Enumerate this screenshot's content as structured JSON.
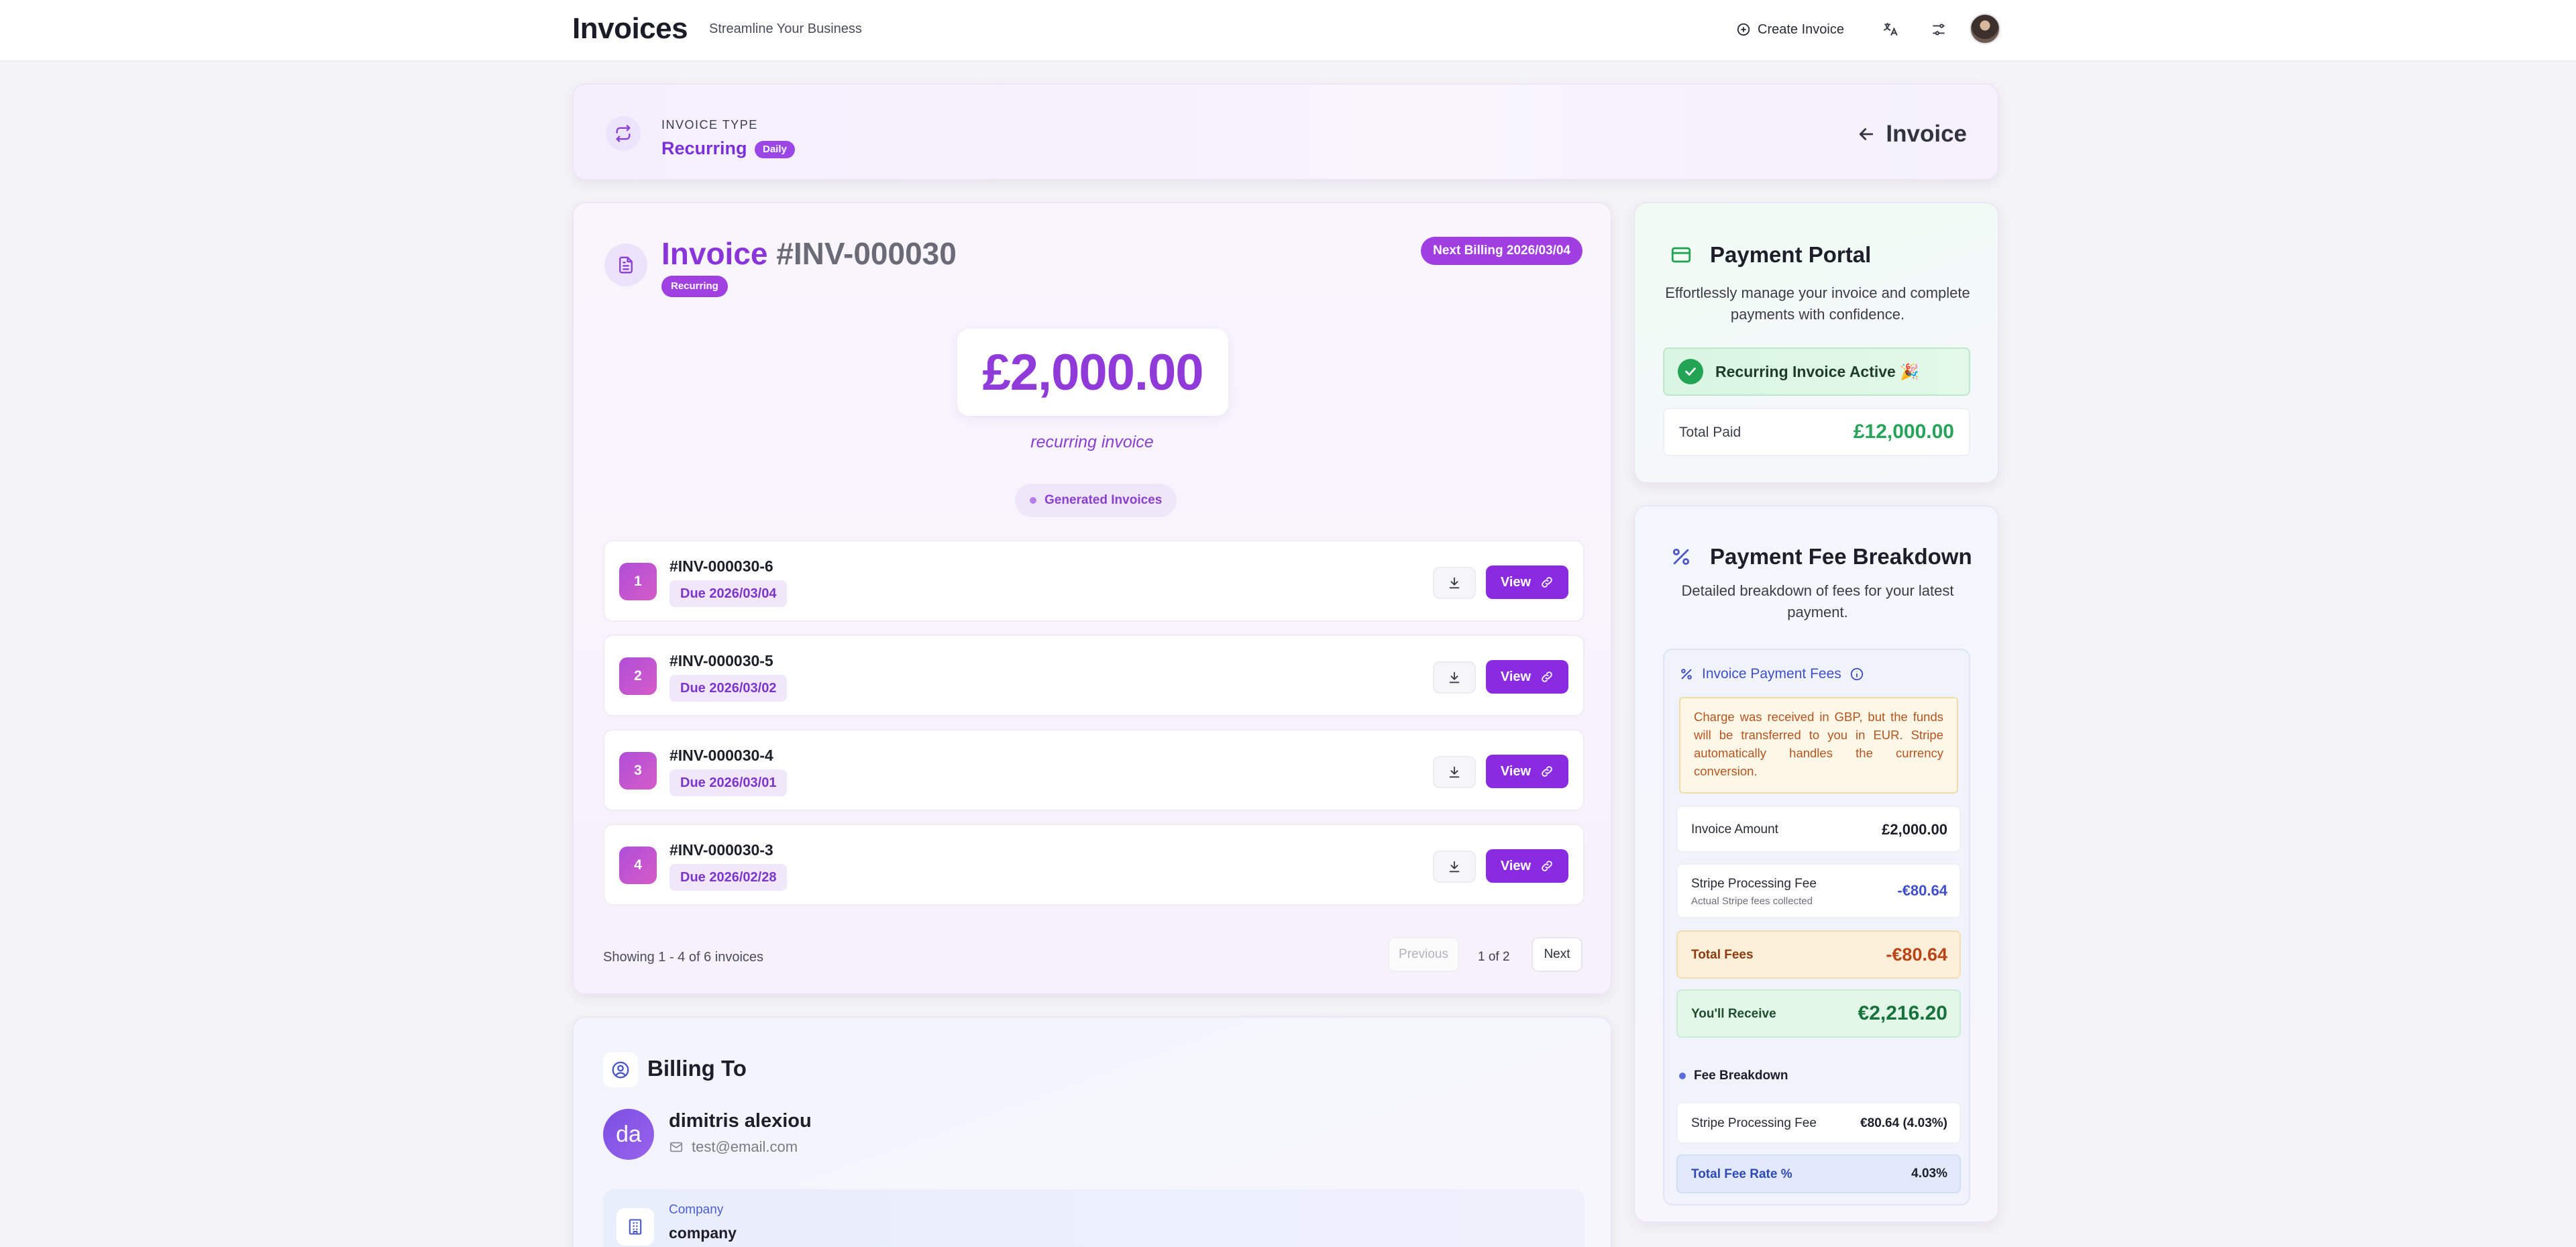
{
  "nav": {
    "brand": "Invoices",
    "tagline": "Streamline Your Business",
    "create_label": "Create Invoice",
    "icons": [
      "plus-circle-icon",
      "translate-icon",
      "sliders-icon",
      "user-avatar"
    ]
  },
  "type_banner": {
    "label": "INVOICE TYPE",
    "value": "Recurring",
    "frequency": "Daily",
    "back_label": "Invoice"
  },
  "invoice": {
    "title_word": "Invoice",
    "number": "#INV-000030",
    "status": "Recurring",
    "next_billing": "Next Billing 2026/03/04",
    "amount": "£2,000.00",
    "amount_note": "recurring invoice",
    "generated_label": "Generated Invoices",
    "rows": [
      {
        "index": "1",
        "id": "#INV-000030-6",
        "due": "Due 2026/03/04",
        "view_label": "View"
      },
      {
        "index": "2",
        "id": "#INV-000030-5",
        "due": "Due 2026/03/02",
        "view_label": "View"
      },
      {
        "index": "3",
        "id": "#INV-000030-4",
        "due": "Due 2026/03/01",
        "view_label": "View"
      },
      {
        "index": "4",
        "id": "#INV-000030-3",
        "due": "Due 2026/02/28",
        "view_label": "View"
      }
    ],
    "showing": "Showing 1 - 4 of 6 invoices",
    "pagination": {
      "prev": "Previous",
      "info": "1 of 2",
      "next": "Next"
    }
  },
  "billing": {
    "title": "Billing To",
    "initials": "da",
    "name": "dimitris alexiou",
    "email": "test@email.com",
    "company_label": "Company",
    "company_value": "company"
  },
  "portal": {
    "title": "Payment Portal",
    "description": "Effortlessly manage your invoice and complete payments with confidence.",
    "active_text": "Recurring Invoice Active 🎉",
    "paid_label": "Total Paid",
    "paid_value": "£12,000.00"
  },
  "fees": {
    "title": "Payment Fee Breakdown",
    "description": "Detailed breakdown of fees for your latest payment.",
    "section_title": "Invoice Payment Fees",
    "notice": "Charge was received in GBP, but the funds will be transferred to you in EUR. Stripe automatically handles the currency conversion.",
    "invoice_amount_label": "Invoice Amount",
    "invoice_amount_value": "£2,000.00",
    "stripe_fee_label": "Stripe Processing Fee",
    "stripe_fee_sub": "Actual Stripe fees collected",
    "stripe_fee_value": "-€80.64",
    "total_fees_label": "Total Fees",
    "total_fees_value": "-€80.64",
    "receive_label": "You'll Receive",
    "receive_value": "€2,216.20",
    "breakdown_title": "Fee Breakdown",
    "breakdown_fee_label": "Stripe Processing Fee",
    "breakdown_fee_value": "€80.64 (4.03%)",
    "rate_label": "Total Fee Rate %",
    "rate_value": "4.03%"
  },
  "colors": {
    "accent": "#8a2be2",
    "success": "#27a35a",
    "warning": "#b84517",
    "info": "#3f4fc9"
  }
}
